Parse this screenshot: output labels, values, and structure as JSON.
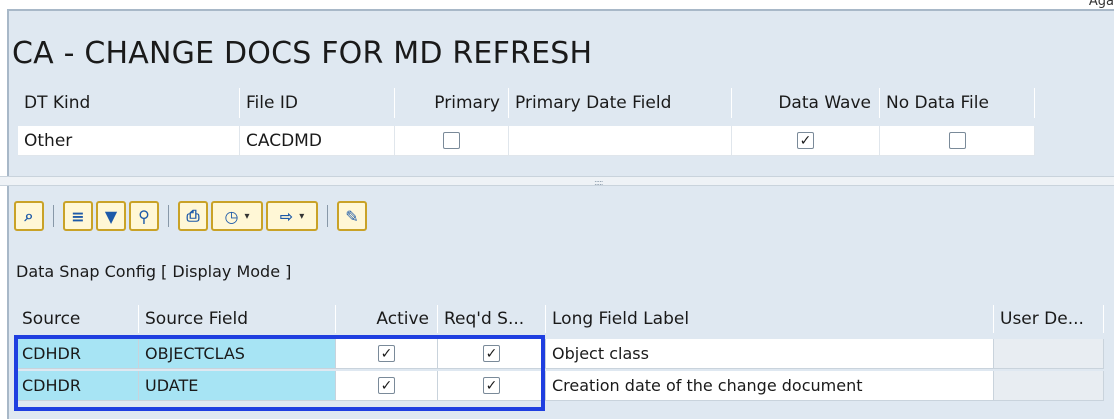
{
  "corner_text": "Aga",
  "title": "CA - CHANGE DOCS FOR MD REFRESH",
  "header_table": {
    "columns": [
      "DT Kind",
      "File ID",
      "Primary",
      "Primary Date Field",
      "Data Wave",
      "No Data File"
    ],
    "row": {
      "dt_kind": "Other",
      "file_id": "CACDMD",
      "primary": false,
      "primary_date_field": "",
      "data_wave": true,
      "no_data_file": false
    }
  },
  "splitter_grip": ":::::",
  "toolbar": {
    "buttons": [
      {
        "icon": "detail-icon",
        "glyph": "🔍"
      },
      {
        "icon": "align-icon",
        "glyph": "≡"
      },
      {
        "icon": "filter-icon",
        "glyph": "⊤"
      },
      {
        "icon": "find-icon",
        "glyph": "⌕"
      },
      {
        "icon": "print-icon",
        "glyph": "⎙"
      },
      {
        "icon": "layout-icon",
        "glyph": "◷"
      },
      {
        "icon": "export-icon",
        "glyph": "⇨"
      },
      {
        "icon": "change-settings-icon",
        "glyph": "✎"
      }
    ]
  },
  "section_label": "Data Snap Config [ Display Mode ]",
  "grid": {
    "columns": [
      "Source",
      "Source Field",
      "Active",
      "Req'd S...",
      "Long Field Label",
      "User De..."
    ],
    "rows": [
      {
        "source": "CDHDR",
        "source_field": "OBJECTCLAS",
        "active": true,
        "reqd": true,
        "label": "Object class",
        "user_de": ""
      },
      {
        "source": "CDHDR",
        "source_field": "UDATE",
        "active": true,
        "reqd": true,
        "label": "Creation date of the change document",
        "user_de": ""
      }
    ]
  },
  "colors": {
    "key_cell": "#a7e4f4",
    "highlight_border": "#1f3fe0",
    "panel_bg": "#dfe8f1"
  }
}
